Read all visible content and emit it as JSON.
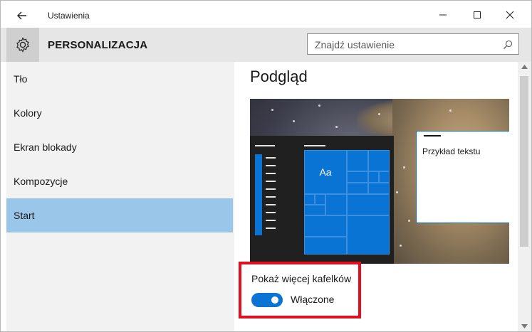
{
  "window": {
    "title": "Ustawienia"
  },
  "titlebar": {
    "icons": [
      "back-arrow-icon",
      "minimize-icon",
      "maximize-icon",
      "close-icon"
    ]
  },
  "header": {
    "section_title": "PERSONALIZACJA",
    "icon": "gear-icon",
    "search_placeholder": "Znajdź ustawienie"
  },
  "sidebar": {
    "items": [
      {
        "label": "Tło"
      },
      {
        "label": "Kolory"
      },
      {
        "label": "Ekran blokady"
      },
      {
        "label": "Kompozycje"
      },
      {
        "label": "Start",
        "active": true
      }
    ]
  },
  "main": {
    "title": "Podgląd",
    "preview": {
      "tile_label": "Aa",
      "sample_text": "Przykład tekstu"
    },
    "setting": {
      "label": "Pokaż więcej kafelków",
      "state": "Włączone",
      "enabled": true
    }
  },
  "colors": {
    "accent": "#0a74d4",
    "active_sidebar": "#9ac6ea",
    "highlight_box": "#e0101e"
  }
}
